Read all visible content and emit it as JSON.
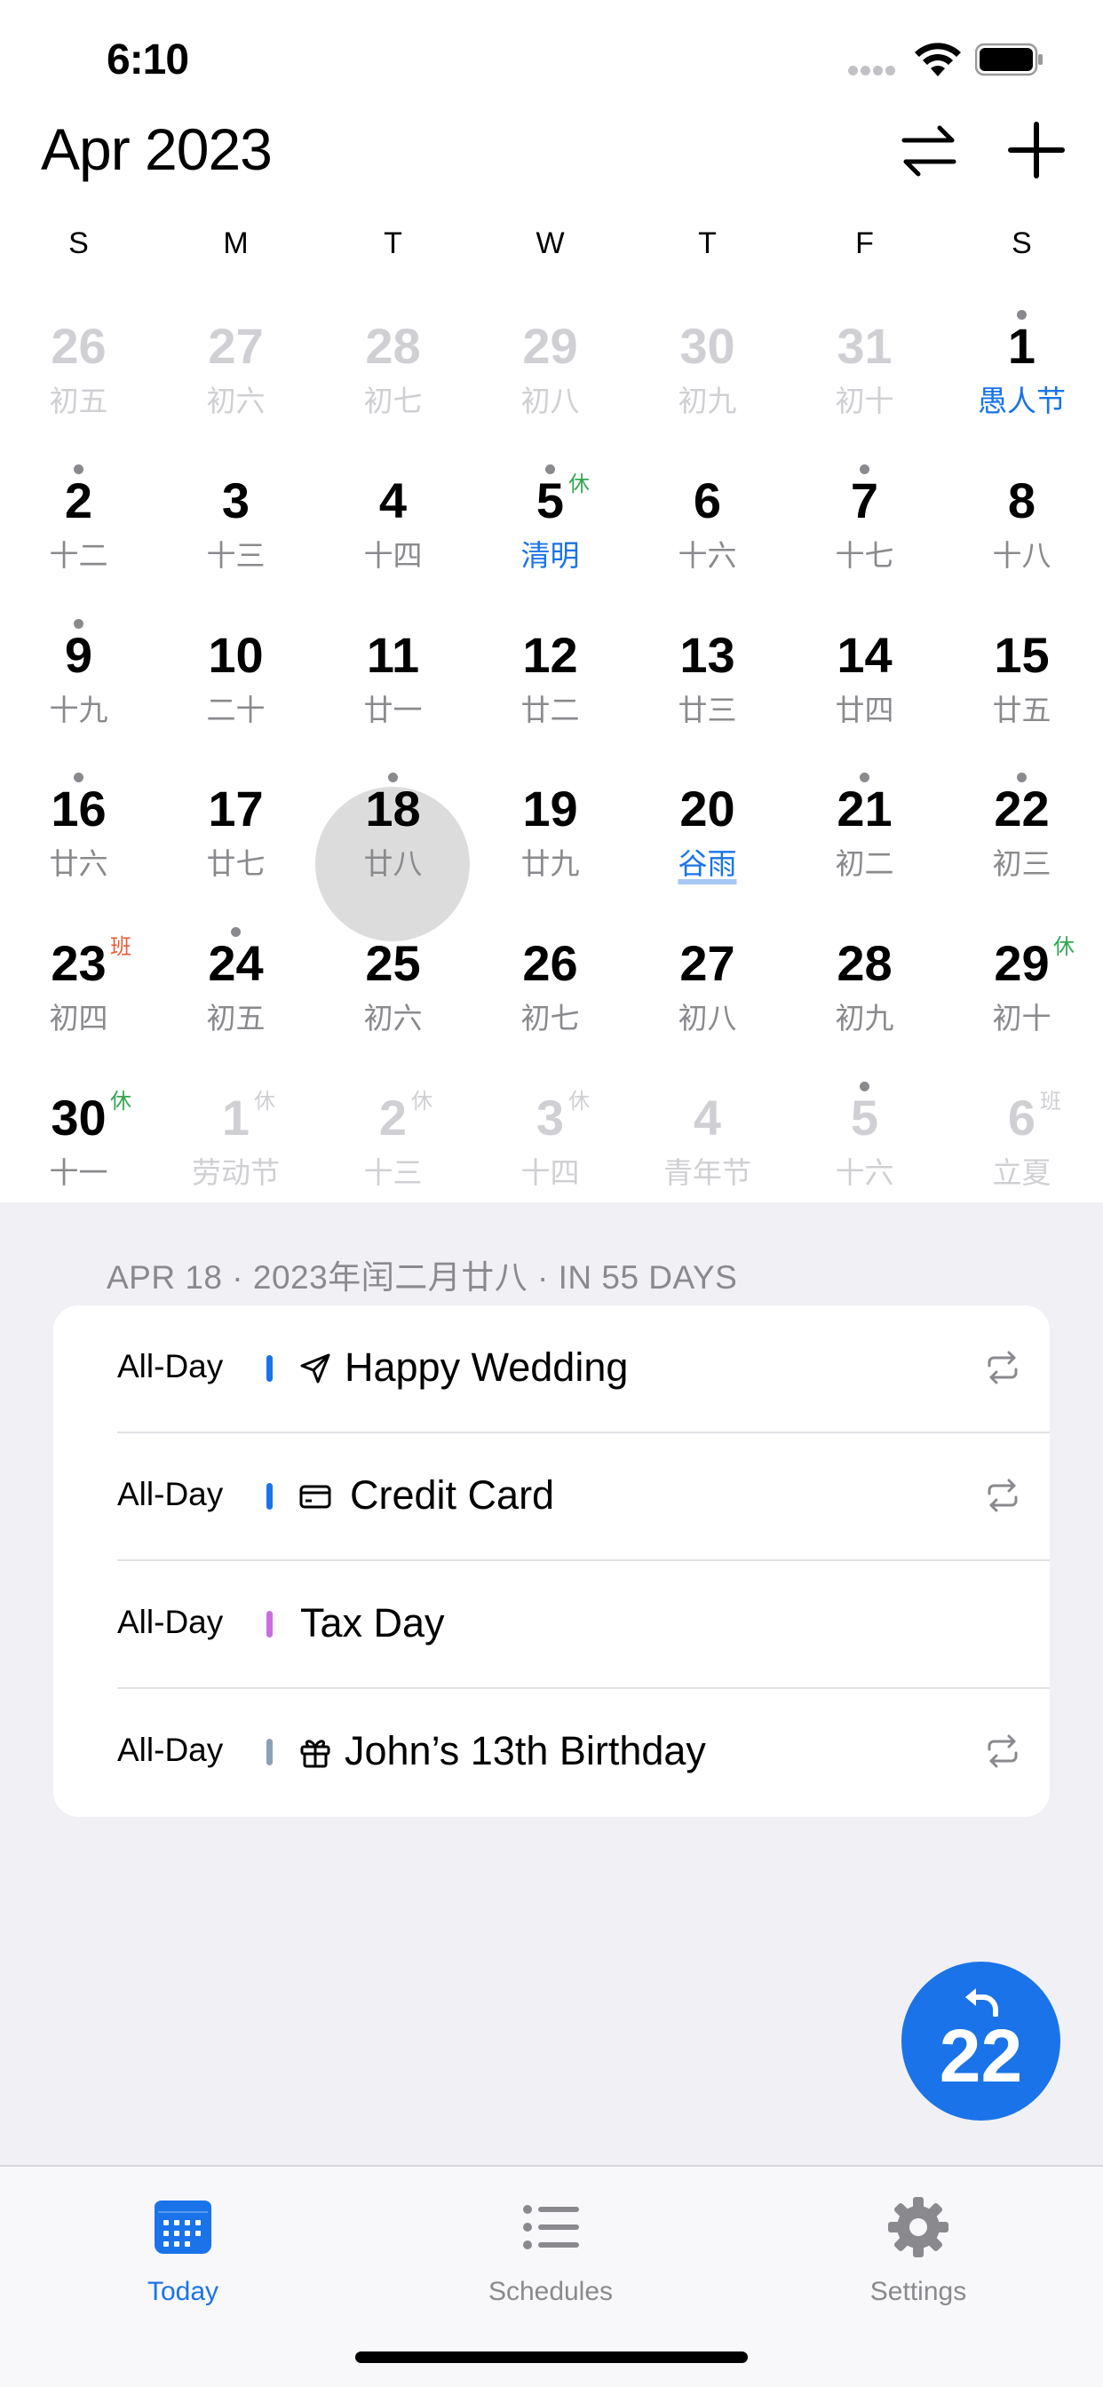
{
  "status_bar": {
    "time": "6:10"
  },
  "header": {
    "title": "Apr 2023"
  },
  "weekdays": [
    "S",
    "M",
    "T",
    "W",
    "T",
    "F",
    "S"
  ],
  "calendar": {
    "days": [
      {
        "num": "26",
        "lunar": "初五",
        "other": true
      },
      {
        "num": "27",
        "lunar": "初六",
        "other": true
      },
      {
        "num": "28",
        "lunar": "初七",
        "other": true
      },
      {
        "num": "29",
        "lunar": "初八",
        "other": true
      },
      {
        "num": "30",
        "lunar": "初九",
        "other": true
      },
      {
        "num": "31",
        "lunar": "初十",
        "other": true
      },
      {
        "num": "1",
        "lunar": "愚人节",
        "festival": true,
        "dot": true
      },
      {
        "num": "2",
        "lunar": "十二",
        "dot": true
      },
      {
        "num": "3",
        "lunar": "十三"
      },
      {
        "num": "4",
        "lunar": "十四"
      },
      {
        "num": "5",
        "lunar": "清明",
        "festival": true,
        "dot": true,
        "badge": "休",
        "badge_type": "rest"
      },
      {
        "num": "6",
        "lunar": "十六"
      },
      {
        "num": "7",
        "lunar": "十七",
        "dot": true
      },
      {
        "num": "8",
        "lunar": "十八"
      },
      {
        "num": "9",
        "lunar": "十九",
        "dot": true
      },
      {
        "num": "10",
        "lunar": "二十"
      },
      {
        "num": "11",
        "lunar": "廿一"
      },
      {
        "num": "12",
        "lunar": "廿二"
      },
      {
        "num": "13",
        "lunar": "廿三"
      },
      {
        "num": "14",
        "lunar": "廿四"
      },
      {
        "num": "15",
        "lunar": "廿五"
      },
      {
        "num": "16",
        "lunar": "廿六",
        "dot": true
      },
      {
        "num": "17",
        "lunar": "廿七"
      },
      {
        "num": "18",
        "lunar": "廿八",
        "dot": true,
        "selected": true
      },
      {
        "num": "19",
        "lunar": "廿九"
      },
      {
        "num": "20",
        "lunar": "谷雨",
        "term": true
      },
      {
        "num": "21",
        "lunar": "初二",
        "dot": true
      },
      {
        "num": "22",
        "lunar": "初三",
        "dot": true
      },
      {
        "num": "23",
        "lunar": "初四",
        "badge": "班",
        "badge_type": "work"
      },
      {
        "num": "24",
        "lunar": "初五",
        "dot": true
      },
      {
        "num": "25",
        "lunar": "初六"
      },
      {
        "num": "26",
        "lunar": "初七"
      },
      {
        "num": "27",
        "lunar": "初八"
      },
      {
        "num": "28",
        "lunar": "初九"
      },
      {
        "num": "29",
        "lunar": "初十",
        "badge": "休",
        "badge_type": "rest"
      },
      {
        "num": "30",
        "lunar": "十一",
        "badge": "休",
        "badge_type": "rest"
      },
      {
        "num": "1",
        "lunar": "劳动节",
        "other": true,
        "badge": "休",
        "badge_type": "rest"
      },
      {
        "num": "2",
        "lunar": "十三",
        "other": true,
        "badge": "休",
        "badge_type": "rest"
      },
      {
        "num": "3",
        "lunar": "十四",
        "other": true,
        "badge": "休",
        "badge_type": "rest"
      },
      {
        "num": "4",
        "lunar": "青年节",
        "other": true
      },
      {
        "num": "5",
        "lunar": "十六",
        "other": true,
        "dot": true
      },
      {
        "num": "6",
        "lunar": "立夏",
        "other": true,
        "badge": "班",
        "badge_type": "work"
      }
    ]
  },
  "selected_date_header": "APR 18 · 2023年闰二月廿八 · IN 55 DAYS",
  "events": [
    {
      "time": "All-Day",
      "title": "Happy Wedding",
      "color": "#1a73e8",
      "icon": "paper-plane-icon",
      "repeat": true
    },
    {
      "time": "All-Day",
      "title": "Credit Card",
      "color": "#1a73e8",
      "icon": "credit-card-icon",
      "repeat": true
    },
    {
      "time": "All-Day",
      "title": "Tax Day",
      "color": "#c86ee0",
      "icon": "",
      "repeat": false
    },
    {
      "time": "All-Day",
      "title": "John’s 13th Birthday",
      "color": "#8aa0b8",
      "icon": "gift-icon",
      "repeat": true
    }
  ],
  "fab": {
    "label": "22"
  },
  "tabs": [
    {
      "label": "Today",
      "icon": "calendar-icon",
      "active": true
    },
    {
      "label": "Schedules",
      "icon": "list-icon",
      "active": false
    },
    {
      "label": "Settings",
      "icon": "gear-icon",
      "active": false
    }
  ],
  "colors": {
    "accent": "#1a73e8",
    "rest": "#34a853",
    "work": "#ea5a36",
    "lower_bg": "#f0f0f5"
  }
}
